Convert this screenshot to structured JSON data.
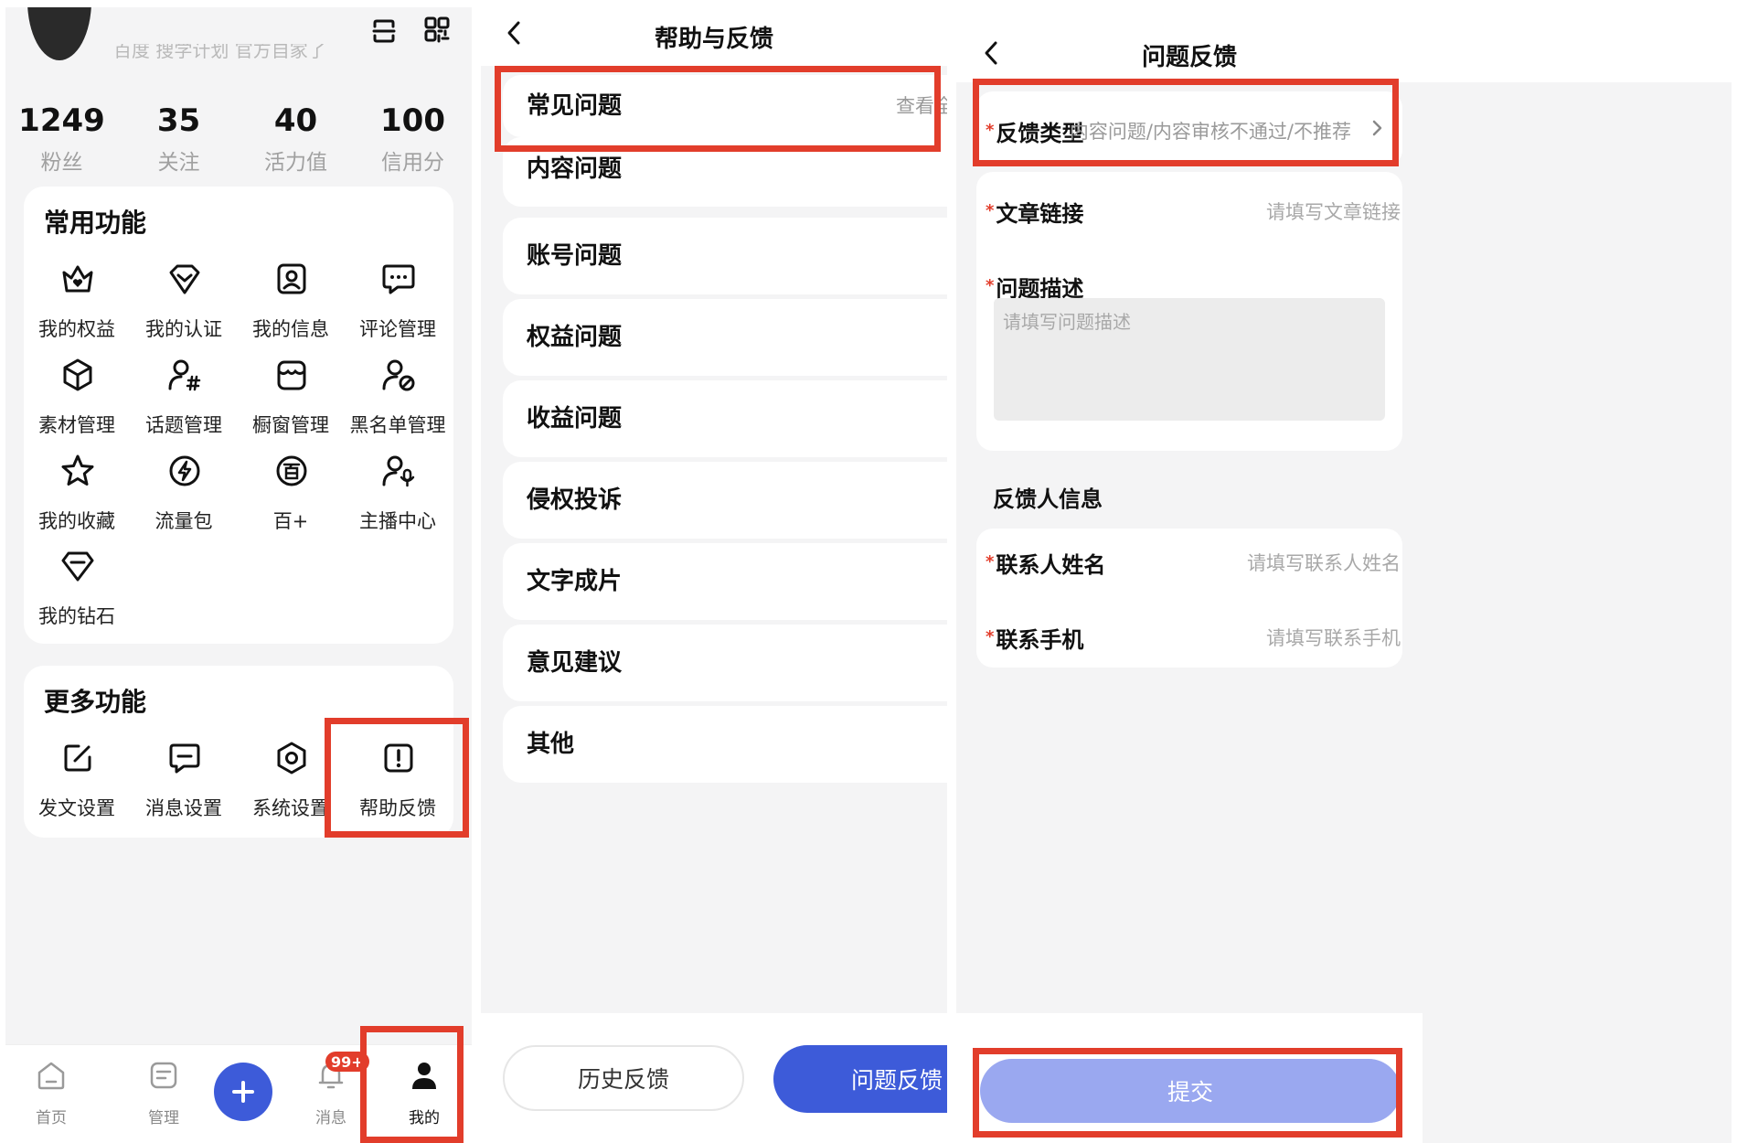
{
  "profile": {
    "subtitle_cut": "百度 搜学计划 官方自家了",
    "stats": [
      {
        "value": "1249",
        "label": "粉丝"
      },
      {
        "value": "35",
        "label": "关注"
      },
      {
        "value": "40",
        "label": "活力值"
      },
      {
        "value": "100",
        "label": "信用分"
      }
    ]
  },
  "common": {
    "title": "常用功能",
    "items": [
      {
        "label": "我的权益",
        "icon": "crown-heart-icon"
      },
      {
        "label": "我的认证",
        "icon": "diamond-heart-icon"
      },
      {
        "label": "我的信息",
        "icon": "id-card-icon"
      },
      {
        "label": "评论管理",
        "icon": "comment-icon"
      },
      {
        "label": "素材管理",
        "icon": "cube-icon"
      },
      {
        "label": "话题管理",
        "icon": "topic-person-icon"
      },
      {
        "label": "橱窗管理",
        "icon": "storefront-icon"
      },
      {
        "label": "黑名单管理",
        "icon": "blocked-user-icon"
      },
      {
        "label": "我的收藏",
        "icon": "star-icon"
      },
      {
        "label": "流量包",
        "icon": "lightning-icon"
      },
      {
        "label": "百+",
        "icon": "bai-plus-icon"
      },
      {
        "label": "主播中心",
        "icon": "anchor-mic-icon"
      },
      {
        "label": "我的钻石",
        "icon": "gem-icon"
      }
    ]
  },
  "more": {
    "title": "更多功能",
    "items": [
      {
        "label": "发文设置",
        "icon": "edit-icon"
      },
      {
        "label": "消息设置",
        "icon": "message-icon"
      },
      {
        "label": "系统设置",
        "icon": "settings-icon"
      },
      {
        "label": "帮助反馈",
        "icon": "help-alert-icon"
      }
    ]
  },
  "bottom_nav": [
    {
      "label": "首页",
      "icon": "home-icon"
    },
    {
      "label": "管理",
      "icon": "manage-icon"
    },
    {
      "label": "",
      "icon": "plus-icon"
    },
    {
      "label": "消息",
      "icon": "bell-icon",
      "badge": "99+"
    },
    {
      "label": "我的",
      "icon": "user-icon"
    }
  ],
  "help": {
    "title": "帮助与反馈",
    "faq_label": "常见问题",
    "faq_view_all": "查看全部",
    "categories": [
      "内容问题",
      "账号问题",
      "权益问题",
      "收益问题",
      "侵权投诉",
      "文字成片",
      "意见建议",
      "其他"
    ],
    "history_button": "历史反馈",
    "feedback_button": "问题反馈"
  },
  "feedback": {
    "title": "问题反馈",
    "required_mark": "*",
    "type_label": "反馈类型",
    "type_value": "内容问题/内容审核不通过/不推荐",
    "link_label": "文章链接",
    "link_placeholder": "请填写文章链接",
    "desc_label": "问题描述",
    "desc_placeholder": "请填写问题描述",
    "contact_section": "反馈人信息",
    "name_label": "联系人姓名",
    "name_placeholder": "请填写联系人姓名",
    "phone_label": "联系手机",
    "phone_placeholder": "请填写联系手机",
    "submit": "提交"
  },
  "colors": {
    "highlight": "#e23d2b",
    "primary_blue": "#3d5bd9",
    "submit_disabled": "#9aa8f0",
    "badge_red": "#e23d2b"
  }
}
